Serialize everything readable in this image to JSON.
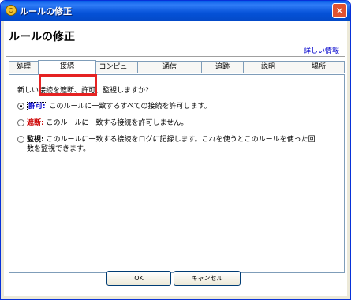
{
  "window": {
    "title": "ルールの修正",
    "close_glyph": "✕"
  },
  "header": {
    "title": "ルールの修正",
    "details_link": "詳しい情報"
  },
  "tabs": [
    {
      "label": "処理"
    },
    {
      "label": "接続"
    },
    {
      "label": "コンピュータ"
    },
    {
      "label": "通信"
    },
    {
      "label": "追跡"
    },
    {
      "label": "説明"
    },
    {
      "label": "場所"
    }
  ],
  "active_tab": "接続",
  "panel": {
    "question": "新しい接続を遮断、許可、監視しますか?",
    "options": [
      {
        "label": "許可:",
        "text": "このルールに一致するすべての接続を許可します。",
        "selected": true
      },
      {
        "label": "遮断:",
        "text": "このルールに一致する接続を許可しません。",
        "selected": false
      },
      {
        "label": "監視:",
        "text_line1": "このルールに一致する接続をログに記録します。これを使うとこのルールを使った回",
        "text_line2": "数を監視できます。",
        "selected": false
      }
    ]
  },
  "buttons": {
    "ok": "OK",
    "cancel": "キャンセル"
  },
  "colors": {
    "titlebar": "#0552d8",
    "highlight": "#e52222",
    "allow_label": "#0000cc",
    "block_label": "#cc0000"
  }
}
